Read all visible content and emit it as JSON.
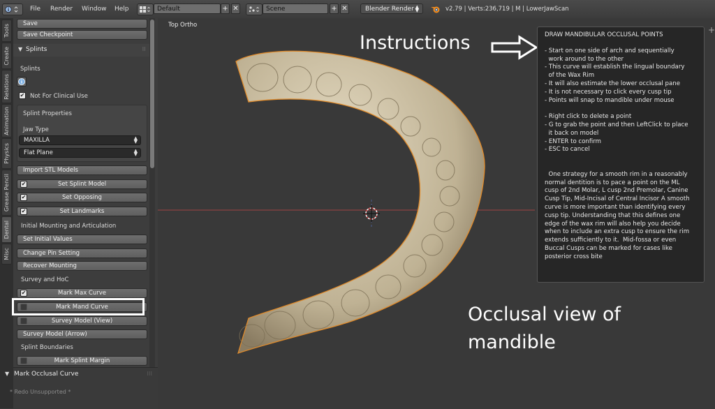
{
  "topbar": {
    "menus": [
      "File",
      "Render",
      "Window",
      "Help"
    ],
    "layout_value": "Default",
    "scene_value": "Scene",
    "render_engine": "Blender Render",
    "info": "v2.79 | Verts:236,719 | M | LowerJawScan"
  },
  "tabs": [
    "Tools",
    "Create",
    "Relations",
    "Animation",
    "Physics",
    "Grease Pencil",
    "Dental",
    "Misc"
  ],
  "panel": {
    "save": "Save",
    "save_checkpoint": "Save Checkpoint",
    "splints_header": "Splints",
    "splints_label": "Splints",
    "not_clinical": "Not For Clinical Use",
    "splint_properties": "Splint Properties",
    "jaw_type_label": "Jaw Type",
    "jaw_type_value": "MAXILLA",
    "plane_value": "Flat Plane",
    "import_stl": "Import STL Models",
    "set_splint_model": "Set Splint Model",
    "set_opposing": "Set Opposing",
    "set_landmarks": "Set Landmarks",
    "initial_mounting": "Initial Mounting and Articulation",
    "set_initial_values": "Set Initial Values",
    "change_pin": "Change Pin Setting",
    "recover_mounting": "Recover Mounting",
    "survey_hoc": "Survey and HoC",
    "mark_max_curve": "Mark Max Curve",
    "mark_mand_curve": "Mark Mand Curve",
    "survey_model_view": "Survey Model (View)",
    "survey_model_arrow": "Survey Model (Arrow)",
    "splint_boundaries": "Splint Boundaries",
    "mark_splint_margin": "Mark Splint Margin",
    "operator_header": "Mark Occlusal Curve",
    "redo_unsupported": "* Redo Unsupported *"
  },
  "viewport": {
    "view_label": "Top Ortho",
    "instructions_callout": "Instructions",
    "occlusal_caption": "Occlusal view of\nmandible",
    "instruction_title": "DRAW MANDIBULAR OCCLUSAL POINTS",
    "instruction_body": "- Start on one side of arch and sequentially\n  work around to the other\n- This curve will establish the lingual boundary\n  of the Wax Rim\n- It will also estimate the lower occlusal pane\n- It is not necessary to click every cusp tip\n- Points will snap to mandible under mouse\n\n- Right click to delete a point\n- G to grab the point and then LeftClick to place\n  it back on model\n- ENTER to confirm\n- ESC to cancel\n\n\n  One strategy for a smooth rim in a reasonably\nnormal dentition is to pace a point on the ML\ncusp of 2nd Molar, L cusp 2nd Premolar, Canine\nCusp Tip, Mid-Incisal of Central Incisor A smooth\ncurve is more important than identifying every\ncusp tip. Understanding that this defines one\nedge of the wax rim will also help you decide\nwhen to include an extra cusp to ensure the rim\nextends sufficiently to it.  Mid-fossa or even\nBuccal Cusps can be marked for cases like\nposterior cross bite"
  },
  "colors": {
    "model": "#cbbfa4",
    "model_outline": "#e08a2a",
    "highlight_box": "#ffffff",
    "x_axis": "#b04040"
  }
}
